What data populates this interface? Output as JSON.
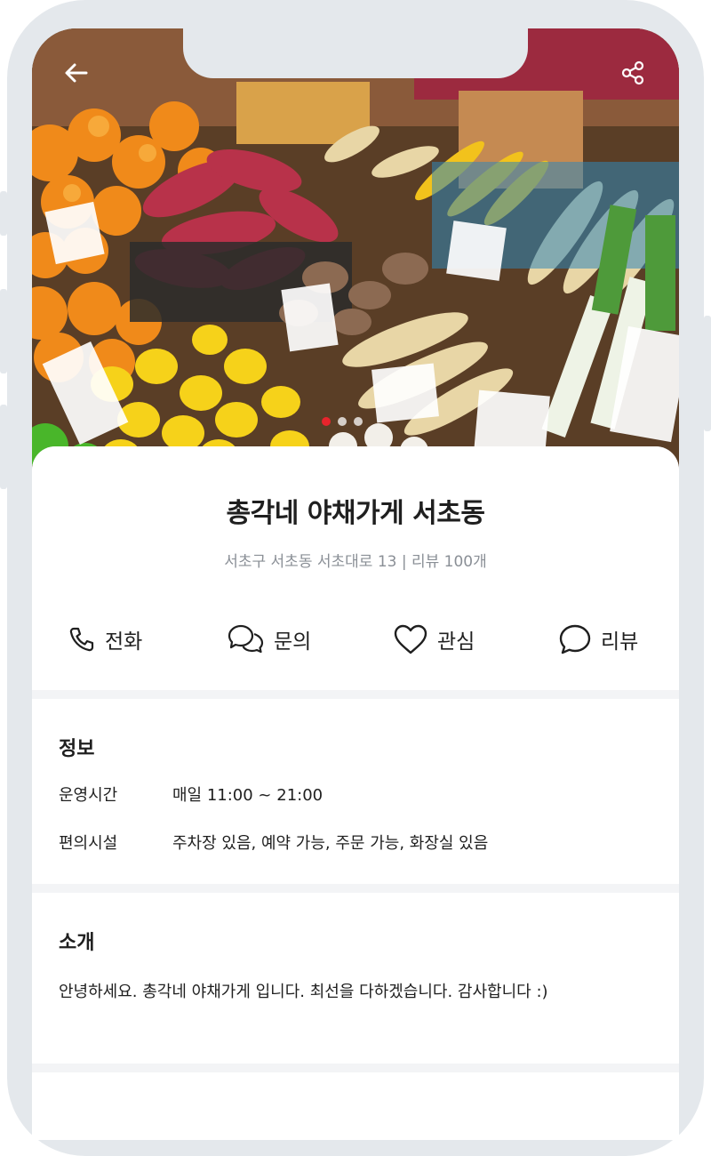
{
  "store": {
    "name": "총각네 야채가게 서초동",
    "subtitle": "서초구 서초동 서초대로 13 | 리뷰 100개"
  },
  "hero": {
    "back_icon": "arrow-left-icon",
    "share_icon": "share-icon",
    "carousel": {
      "total": 3,
      "active_index": 1
    }
  },
  "actions": [
    {
      "label": "전화",
      "icon": "phone-icon"
    },
    {
      "label": "문의",
      "icon": "chat-bubbles-icon"
    },
    {
      "label": "관심",
      "icon": "heart-icon"
    },
    {
      "label": "리뷰",
      "icon": "speech-bubble-icon"
    }
  ],
  "info": {
    "title": "정보",
    "rows": [
      {
        "label": "운영시간",
        "value": "매일 11:00 ~ 21:00"
      },
      {
        "label": "편의시설",
        "value": "주차장 있음, 예약 가능, 주문 가능, 화장실 있음"
      }
    ]
  },
  "intro": {
    "title": "소개",
    "text": "안녕하세요. 총각네 야채가게 입니다. 최선을 다하겠습니다. 감사합니다 :)"
  },
  "colors": {
    "frame": "#e4e8ec",
    "carousel_active": "#e8242c",
    "text": "#1f1f1f",
    "subtext": "#8a8f96"
  }
}
